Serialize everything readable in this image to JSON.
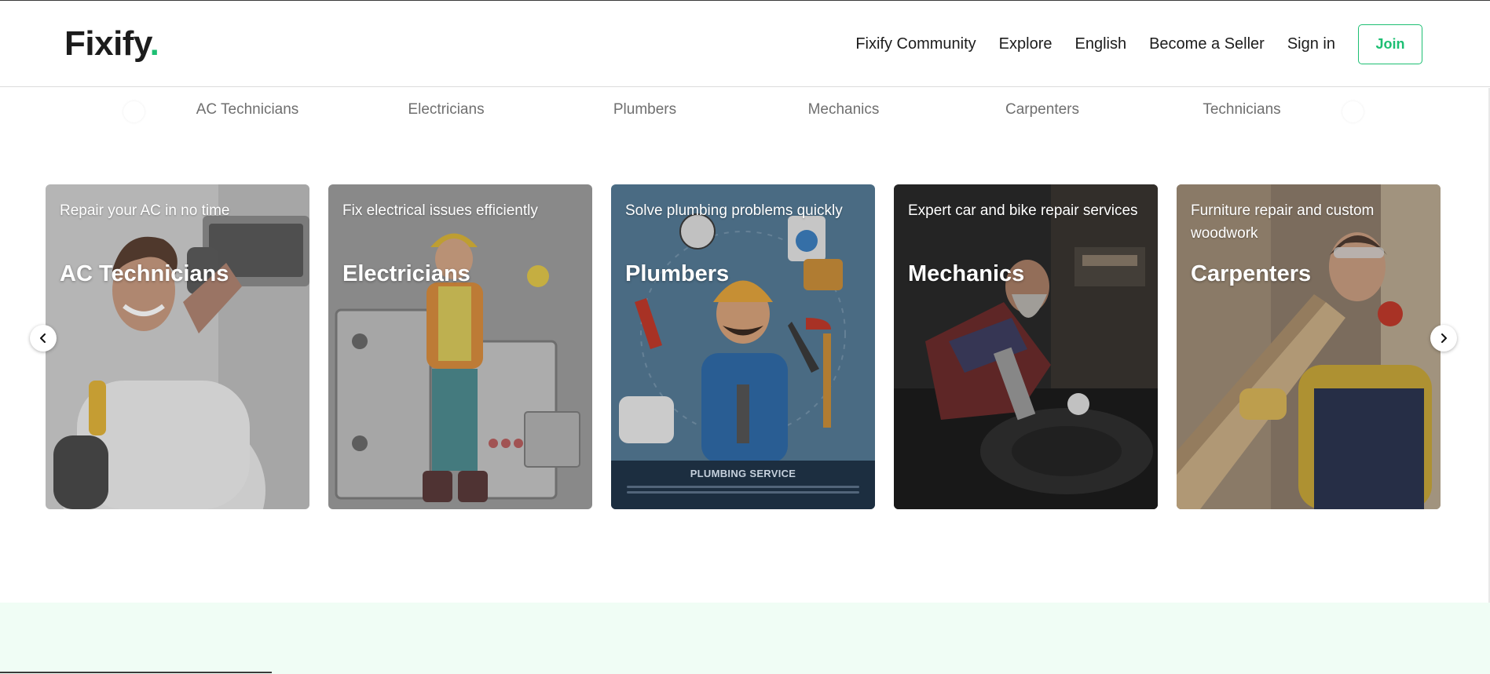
{
  "brand": {
    "name": "Fixify",
    "dot": ".",
    "accent_color": "#1dbf73"
  },
  "nav": {
    "links": [
      "Fixify Community",
      "Explore",
      "English",
      "Become a Seller",
      "Sign in"
    ],
    "join_label": "Join"
  },
  "categories": [
    "AC Technicians",
    "Electricians",
    "Plumbers",
    "Mechanics",
    "Carpenters",
    "Technicians"
  ],
  "cards": [
    {
      "subtitle": "Repair your AC in no time",
      "title": "AC Technicians"
    },
    {
      "subtitle": "Fix electrical issues efficiently",
      "title": "Electricians"
    },
    {
      "subtitle": "Solve plumbing problems quickly",
      "title": "Plumbers",
      "banner_text": "PLUMBING SERVICE"
    },
    {
      "subtitle": "Expert car and bike repair services",
      "title": "Mechanics"
    },
    {
      "subtitle": "Furniture repair and custom woodwork",
      "title": "Carpenters"
    }
  ],
  "icons": {
    "carousel_prev": "chevron-left-icon",
    "carousel_next": "chevron-right-icon"
  }
}
